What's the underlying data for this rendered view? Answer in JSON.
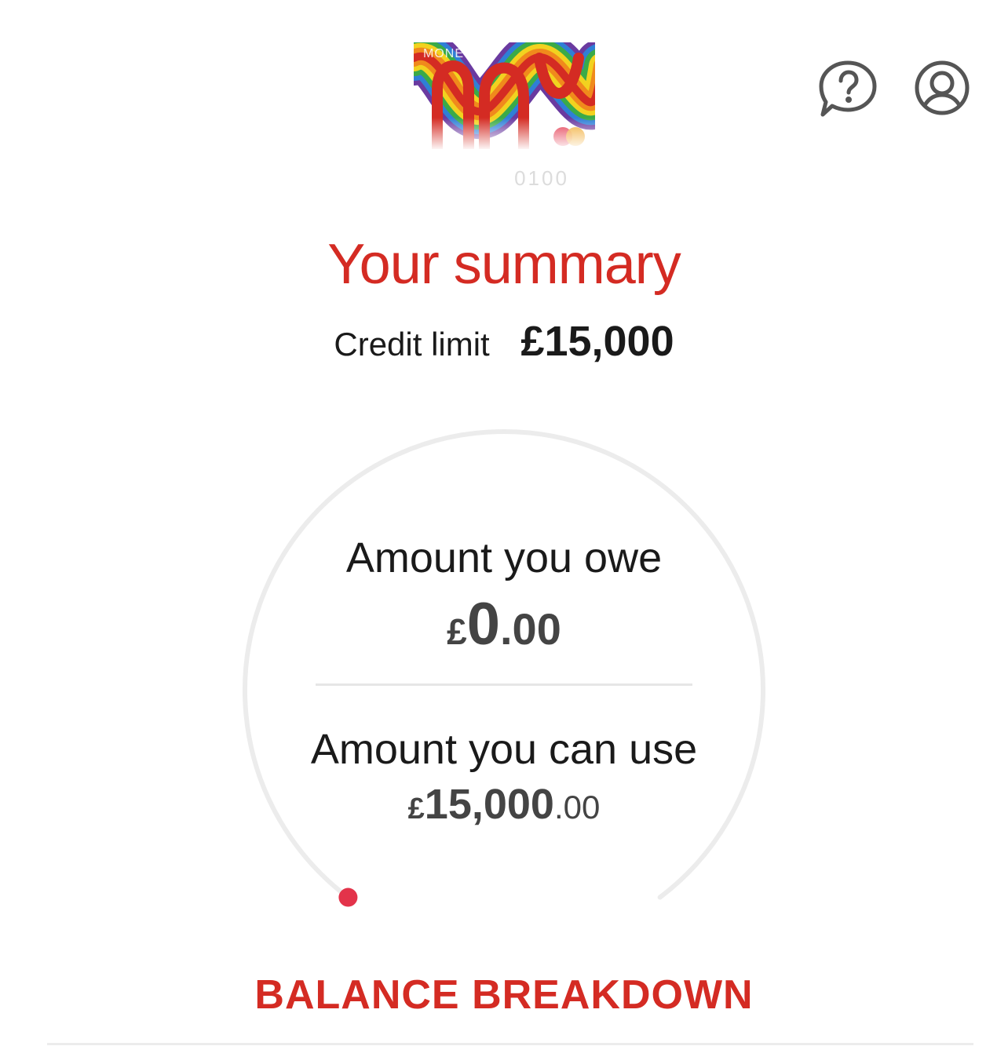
{
  "card": {
    "brand": "MONEY",
    "number_faded": "0100"
  },
  "header": {
    "help_icon": "help-chat-icon",
    "profile_icon": "profile-icon"
  },
  "summary": {
    "title": "Your summary",
    "credit_limit_label": "Credit limit",
    "credit_limit_value": "£15,000"
  },
  "gauge": {
    "owe_label": "Amount you owe",
    "owe_currency": "£",
    "owe_whole": "0",
    "owe_decimal": ".00",
    "use_label": "Amount you can use",
    "use_currency": "£",
    "use_whole": "15,000",
    "use_decimal": ".00",
    "used_fraction": 0,
    "colors": {
      "track": "#ececec",
      "indicator": "#e3334a"
    }
  },
  "balance_breakdown": {
    "label": "BALANCE BREAKDOWN"
  },
  "colors": {
    "brand_red": "#d42b23",
    "text_dark": "#1a1a1a",
    "value_grey": "#444444"
  }
}
